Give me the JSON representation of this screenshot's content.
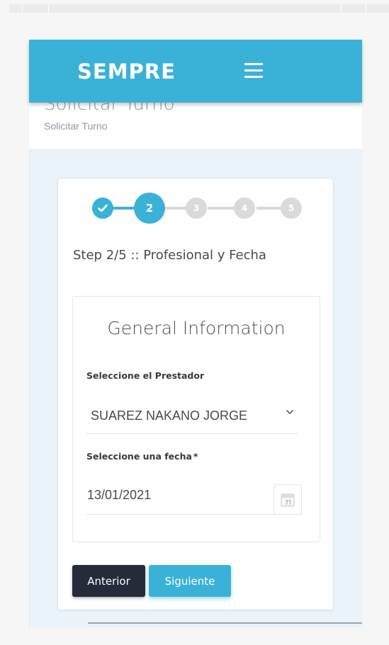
{
  "app": {
    "brand": "SEMPRE"
  },
  "header": {
    "title": "Solicitar Turno",
    "breadcrumb": "Solicitar Turno"
  },
  "wizard": {
    "current_step": 2,
    "total_steps": 5,
    "steps": [
      {
        "label": "",
        "state": "done"
      },
      {
        "label": "2",
        "state": "current"
      },
      {
        "label": "3",
        "state": "pending"
      },
      {
        "label": "4",
        "state": "pending"
      },
      {
        "label": "5",
        "state": "pending"
      }
    ],
    "caption": "Step 2/5 :: Profesional y Fecha"
  },
  "form": {
    "title": "General Information",
    "provider": {
      "label": "Seleccione el Prestador",
      "value": "SUAREZ NAKANO JORGE"
    },
    "date": {
      "label": "Seleccione una fecha",
      "required_mark": "*",
      "value": "13/01/2021"
    }
  },
  "buttons": {
    "previous": "Anterior",
    "next": "Siguiente"
  },
  "colors": {
    "accent": "#3ab2d8",
    "dark_button": "#252b3a",
    "pending_step": "#dadada"
  },
  "icons": {
    "menu": "hamburger-menu-icon",
    "done_step": "check-icon",
    "select": "chevron-down-icon",
    "date": "calendar-icon"
  }
}
